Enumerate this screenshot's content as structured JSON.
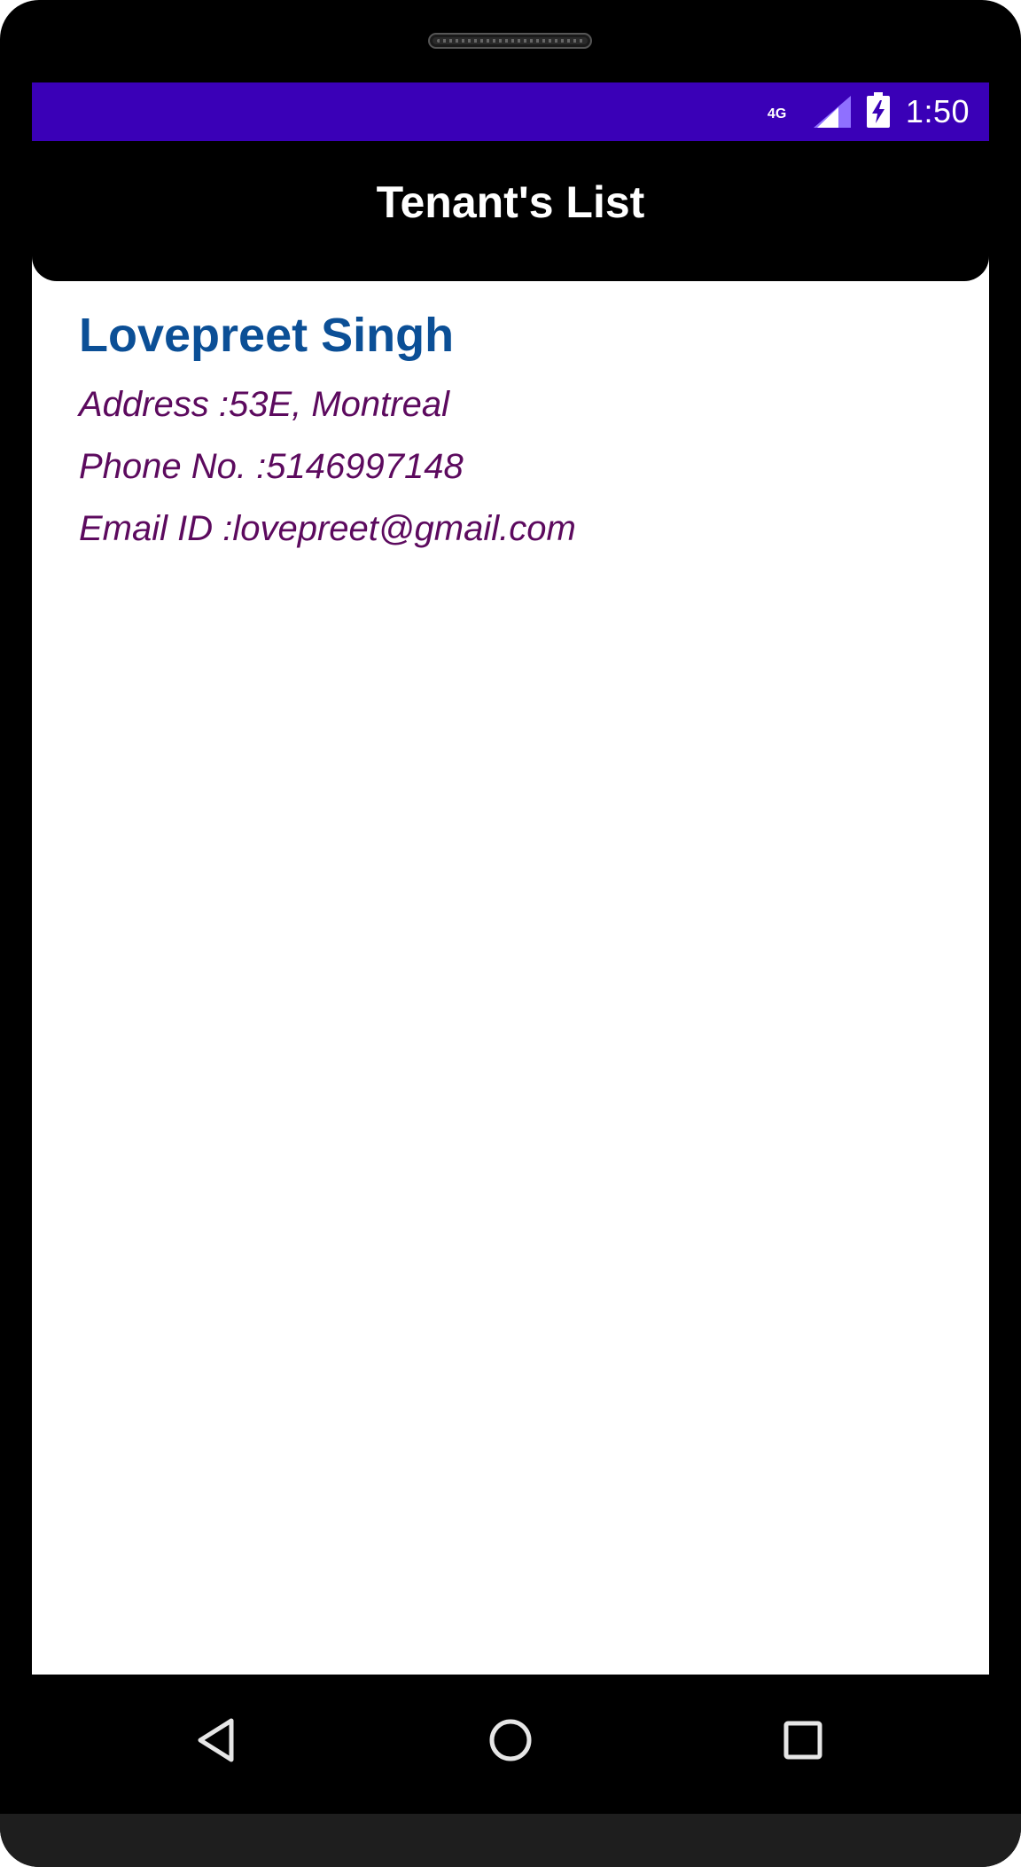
{
  "status_bar": {
    "network_type": "4G",
    "time": "1:50",
    "icons": [
      "signal-icon",
      "battery-charging-icon"
    ]
  },
  "app_bar": {
    "title": "Tenant's List"
  },
  "tenants": [
    {
      "name": "Lovepreet Singh",
      "address": "Address :53E, Montreal",
      "phone": "Phone No. :5146997148",
      "email": "Email ID :lovepreet@gmail.com"
    }
  ],
  "nav_bar": {
    "icons": [
      "back-icon",
      "home-icon",
      "recents-icon"
    ]
  },
  "colors": {
    "status_bar": "#3a00b7",
    "app_bar": "#000000",
    "tenant_name": "#0b4f96",
    "tenant_detail": "#5c0a5e"
  }
}
